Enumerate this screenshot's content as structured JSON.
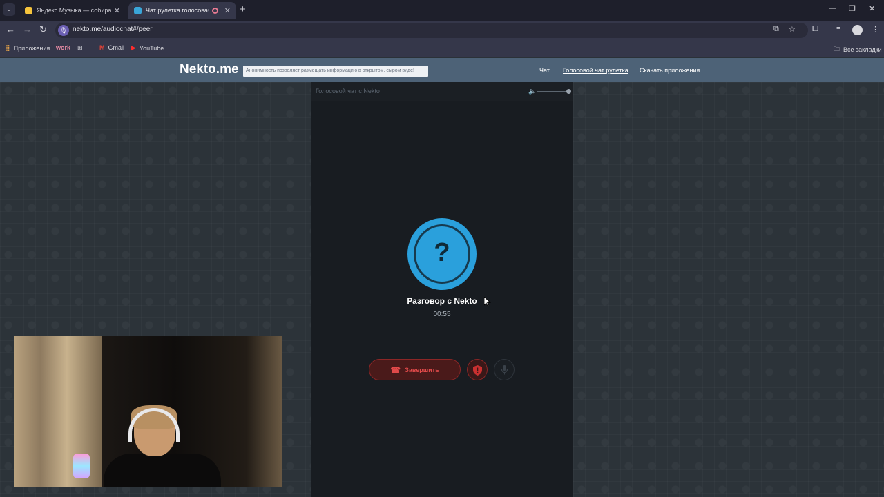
{
  "browser": {
    "tabs": [
      {
        "title": "Яндекс Музыка — собираем м",
        "favicon_color": "#f6c43c"
      },
      {
        "title": "Чат рулетка голосовая — Г",
        "favicon_color": "#3aa6d9",
        "active": true
      }
    ],
    "url": "nekto.me/audiochat#/peer",
    "bookmarks": [
      {
        "label": "Приложения",
        "icon": "apps-grid-icon"
      },
      {
        "label": "work",
        "icon": ""
      },
      {
        "label": "",
        "icon": "grid-icon"
      },
      {
        "label": "Gmail",
        "icon": "gmail-icon"
      },
      {
        "label": "YouTube",
        "icon": "youtube-icon"
      }
    ],
    "all_bookmarks": "Все закладки"
  },
  "site": {
    "logo": "Nekto.me",
    "banner": "Анонимность позволяет размещать информацию в открытом, сыром виде!",
    "nav": [
      {
        "label": "Чат",
        "active": false
      },
      {
        "label": "Голосовой чат рулетка",
        "active": true
      },
      {
        "label": "Скачать приложения",
        "active": false
      }
    ]
  },
  "panel": {
    "title": "Голосовой чат с Nekto",
    "volume": 1.0,
    "avatar_symbol": "?",
    "conversation_title": "Разговор с Nekto",
    "timer": "00:55",
    "end_label": "Завершить"
  },
  "colors": {
    "accent_blue": "#2aa0dc",
    "danger_red": "#e14a4a",
    "header": "#4d6277"
  }
}
